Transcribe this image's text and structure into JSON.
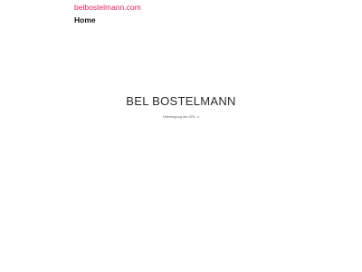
{
  "header": {
    "site_link": "belbostelmann.com",
    "nav_items": [
      {
        "label": "Home"
      }
    ]
  },
  "hero": {
    "title": "BEL BOSTELMANN",
    "meta": "Übertragung der URL. s"
  },
  "colors": {
    "link": "#e0215f",
    "text": "#222222",
    "background": "#ffffff"
  }
}
